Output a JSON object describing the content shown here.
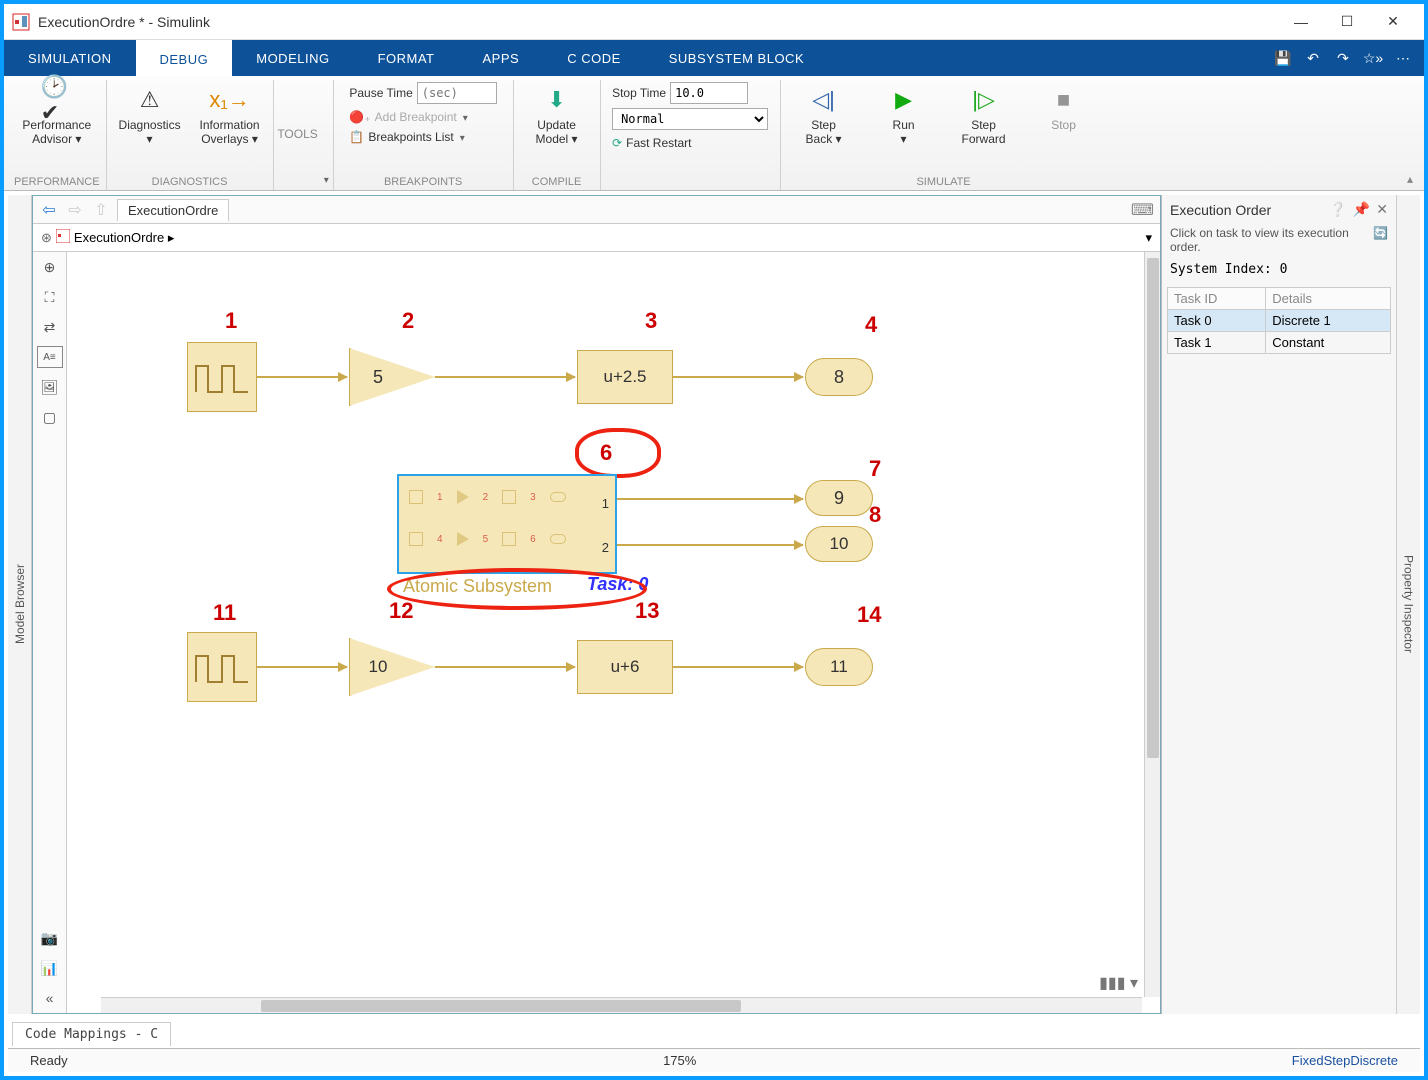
{
  "window": {
    "title": "ExecutionOrdre * - Simulink"
  },
  "tabs": {
    "simulation": "SIMULATION",
    "debug": "DEBUG",
    "modeling": "MODELING",
    "format": "FORMAT",
    "apps": "APPS",
    "ccode": "C CODE",
    "subsystem": "SUBSYSTEM BLOCK"
  },
  "ribbon": {
    "performance": {
      "label": "Performance\nAdvisor ▾",
      "group": "PERFORMANCE"
    },
    "diagnostics": {
      "label": "Diagnostics\n▾",
      "info": "Information\nOverlays ▾",
      "group": "DIAGNOSTICS"
    },
    "tools": {
      "label": "TOOLS"
    },
    "breakpoints": {
      "pause_label": "Pause Time",
      "pause_placeholder": "(sec)",
      "add_label": "Add Breakpoint",
      "list_label": "Breakpoints List",
      "group": "BREAKPOINTS"
    },
    "compile": {
      "label": "Update\nModel ▾",
      "group": "COMPILE"
    },
    "sim": {
      "stop_label": "Stop Time",
      "stop_value": "10.0",
      "mode": "Normal",
      "fastrestart": "Fast Restart",
      "stepback": "Step\nBack ▾",
      "run": "Run\n▾",
      "stepfwd": "Step\nForward",
      "stop": "Stop",
      "group": "SIMULATE"
    }
  },
  "nav": {
    "tab": "ExecutionOrdre",
    "path": "ExecutionOrdre ▸"
  },
  "leftcollapsed": "Model Browser",
  "rightcollapsed": "Property Inspector",
  "blocks": {
    "pulse1_num": "1",
    "gain1_num": "2",
    "gain1_val": "5",
    "fcn1_num": "3",
    "fcn1_expr": "u+2.5",
    "disp1_num": "4",
    "disp1_val": "8",
    "subsys_num": "6",
    "subsys_name": "Atomic Subsystem",
    "subsys_task": "Task: 0",
    "subsys_port1": "1",
    "subsys_port2": "2",
    "sub_inner_nums": [
      "1",
      "2",
      "3",
      "4",
      "5",
      "6"
    ],
    "disp2_num": "7",
    "disp2_val": "9",
    "extra_num": "8",
    "disp3_val": "10",
    "pulse2_num": "11",
    "gain2_num": "12",
    "gain2_val": "10",
    "fcn2_num": "13",
    "fcn2_expr": "u+6",
    "disp4_num": "14",
    "disp4_val": "11"
  },
  "execorder": {
    "title": "Execution Order",
    "hint": "Click on task to view its execution order.",
    "sysidx": "System Index: 0",
    "th_task": "Task ID",
    "th_details": "Details",
    "rows": [
      {
        "task": "Task 0",
        "details": "Discrete 1"
      },
      {
        "task": "Task 1",
        "details": "Constant"
      }
    ]
  },
  "codemaps": "Code Mappings - C",
  "status": {
    "ready": "Ready",
    "zoom": "175%",
    "solver": "FixedStepDiscrete"
  }
}
